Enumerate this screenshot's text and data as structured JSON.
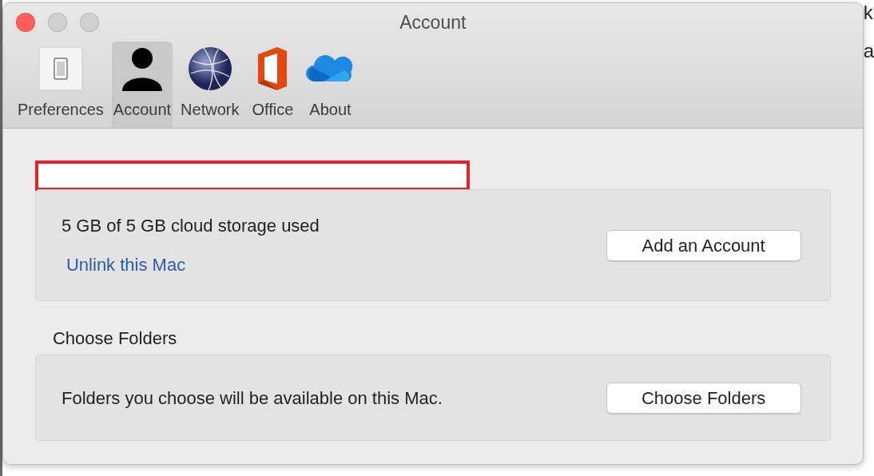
{
  "background": {
    "edge_letters": [
      "k",
      "a"
    ]
  },
  "window": {
    "title": "Account",
    "buttons": [
      {
        "color": "#fe5f57"
      },
      {
        "color": "#d0d0d0"
      },
      {
        "color": "#d0d0d0"
      }
    ]
  },
  "tabs": [
    {
      "label": "Preferences",
      "kind": "switch",
      "selected": false
    },
    {
      "label": "Account",
      "kind": "person",
      "selected": true
    },
    {
      "label": "Network",
      "kind": "globe",
      "selected": false
    },
    {
      "label": "Office",
      "kind": "office",
      "selected": false
    },
    {
      "label": "About",
      "kind": "cloud",
      "selected": false
    }
  ],
  "account": {
    "redacted": true,
    "storage": "5 GB of 5 GB cloud storage used",
    "link": "Unlink this Mac",
    "button": "Add an Account"
  },
  "folders": {
    "heading": "Choose Folders",
    "text": "Folders you choose will be available on this Mac.",
    "button": "Choose Folders"
  }
}
